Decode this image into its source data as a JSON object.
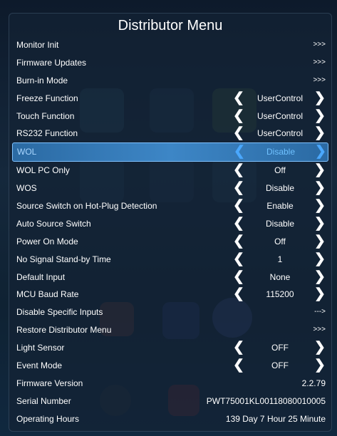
{
  "title": "Distributor Menu",
  "rows": [
    {
      "label": "Monitor Init",
      "more": ">>>"
    },
    {
      "label": "Firmware Updates",
      "more": ">>>"
    },
    {
      "label": "Burn-in Mode",
      "more": ">>>"
    },
    {
      "label": "Freeze Function",
      "value": "UserControl"
    },
    {
      "label": "Touch Function",
      "value": "UserControl"
    },
    {
      "label": "RS232 Function",
      "value": "UserControl"
    },
    {
      "label": "WOL",
      "value": "Disable",
      "selected": true
    },
    {
      "label": "WOL PC Only",
      "value": "Off"
    },
    {
      "label": "WOS",
      "value": "Disable"
    },
    {
      "label": "Source Switch on Hot-Plug Detection",
      "value": "Enable"
    },
    {
      "label": "Auto Source Switch",
      "value": "Disable"
    },
    {
      "label": "Power On Mode",
      "value": "Off"
    },
    {
      "label": "No Signal Stand-by Time",
      "value": "1"
    },
    {
      "label": "Default Input",
      "value": "None"
    },
    {
      "label": "MCU Baud Rate",
      "value": "115200"
    },
    {
      "label": "Disable Specific Inputs",
      "more": "--->"
    },
    {
      "label": "Restore Distributor Menu",
      "more": ">>>"
    },
    {
      "label": "Light Sensor",
      "value": "OFF"
    },
    {
      "label": "Event Mode",
      "value": "OFF"
    },
    {
      "label": "Firmware Version",
      "info": "2.2.79"
    },
    {
      "label": "Serial Number",
      "info": "PWT75001KL00118080010005"
    },
    {
      "label": "Operating Hours",
      "info": "139 Day 7 Hour 25 Minute"
    }
  ],
  "colors": {
    "selected_row": "#3d86c6",
    "selected_text": "#6fc1ff",
    "panel": "#142234",
    "text": "#ffffff"
  },
  "icons": {
    "left_arrow": "chevron-left-icon",
    "right_arrow": "chevron-right-icon"
  }
}
